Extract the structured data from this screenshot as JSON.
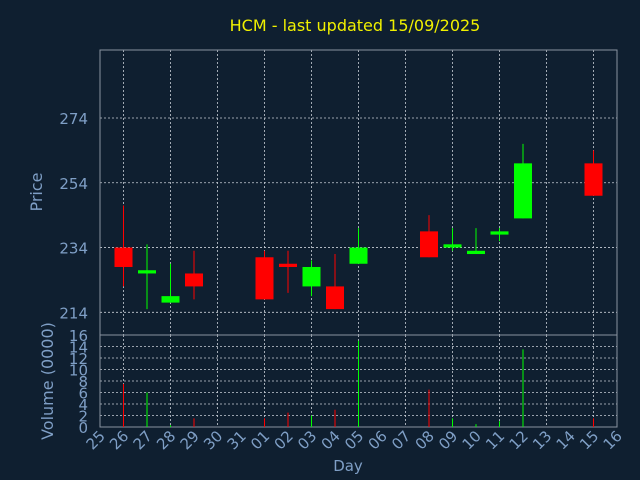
{
  "chart_data": {
    "type": "candlestick",
    "title": "HCM - last updated 15/09/2025",
    "colors": {
      "background": "#0f1f30",
      "plot_border": "#8a93a0",
      "grid": "#c8ced6",
      "axis_text": "#7f9fc6",
      "title": "#f0f000",
      "up": "#00ff00",
      "down": "#ff0000"
    },
    "x_axis": {
      "label": "Day",
      "tick_labels": [
        "25",
        "26",
        "27",
        "28",
        "29",
        "30",
        "31",
        "01",
        "02",
        "03",
        "04",
        "05",
        "06",
        "07",
        "08",
        "09",
        "10",
        "11",
        "12",
        "13",
        "14",
        "15",
        "16"
      ]
    },
    "price_panel": {
      "ylabel": "Price",
      "ylim": [
        207,
        295
      ],
      "ticks": [
        214,
        234,
        254,
        274
      ],
      "candles": [
        {
          "day": "26",
          "open": 234,
          "high": 247,
          "low": 222,
          "close": 228
        },
        {
          "day": "27",
          "open": 226,
          "high": 235,
          "low": 215,
          "close": 227
        },
        {
          "day": "28",
          "open": 217,
          "high": 229,
          "low": 217,
          "close": 219
        },
        {
          "day": "29",
          "open": 226,
          "high": 233,
          "low": 218,
          "close": 222
        },
        {
          "day": "01",
          "open": 231,
          "high": 233,
          "low": 218,
          "close": 218
        },
        {
          "day": "02",
          "open": 229,
          "high": 233,
          "low": 220,
          "close": 228
        },
        {
          "day": "03",
          "open": 222,
          "high": 230,
          "low": 219,
          "close": 228
        },
        {
          "day": "04",
          "open": 222,
          "high": 232,
          "low": 215,
          "close": 215
        },
        {
          "day": "05",
          "open": 229,
          "high": 240,
          "low": 229,
          "close": 234
        },
        {
          "day": "08",
          "open": 239,
          "high": 244,
          "low": 231,
          "close": 231
        },
        {
          "day": "09",
          "open": 234,
          "high": 240,
          "low": 233,
          "close": 235
        },
        {
          "day": "10",
          "open": 232,
          "high": 240,
          "low": 232,
          "close": 233
        },
        {
          "day": "11",
          "open": 238,
          "high": 240,
          "low": 236,
          "close": 239
        },
        {
          "day": "12",
          "open": 243,
          "high": 266,
          "low": 243,
          "close": 260
        },
        {
          "day": "15",
          "open": 260,
          "high": 264,
          "low": 250,
          "close": 250
        }
      ]
    },
    "volume_panel": {
      "ylabel": "Volume (0000)",
      "ylim": [
        0,
        16
      ],
      "ticks": [
        0,
        2,
        4,
        6,
        8,
        10,
        12,
        14,
        16
      ],
      "bars": [
        {
          "day": "26",
          "value": 7.5,
          "color": "down"
        },
        {
          "day": "27",
          "value": 6.0,
          "color": "up"
        },
        {
          "day": "28",
          "value": 0.3,
          "color": "up"
        },
        {
          "day": "29",
          "value": 1.5,
          "color": "down"
        },
        {
          "day": "01",
          "value": 1.5,
          "color": "down"
        },
        {
          "day": "02",
          "value": 2.5,
          "color": "down"
        },
        {
          "day": "03",
          "value": 2.0,
          "color": "up"
        },
        {
          "day": "04",
          "value": 3.0,
          "color": "down"
        },
        {
          "day": "05",
          "value": 15.0,
          "color": "up"
        },
        {
          "day": "08",
          "value": 6.5,
          "color": "down"
        },
        {
          "day": "09",
          "value": 1.5,
          "color": "up"
        },
        {
          "day": "10",
          "value": 0.5,
          "color": "up"
        },
        {
          "day": "11",
          "value": 1.0,
          "color": "up"
        },
        {
          "day": "12",
          "value": 13.5,
          "color": "up"
        },
        {
          "day": "15",
          "value": 1.5,
          "color": "down"
        }
      ]
    }
  }
}
